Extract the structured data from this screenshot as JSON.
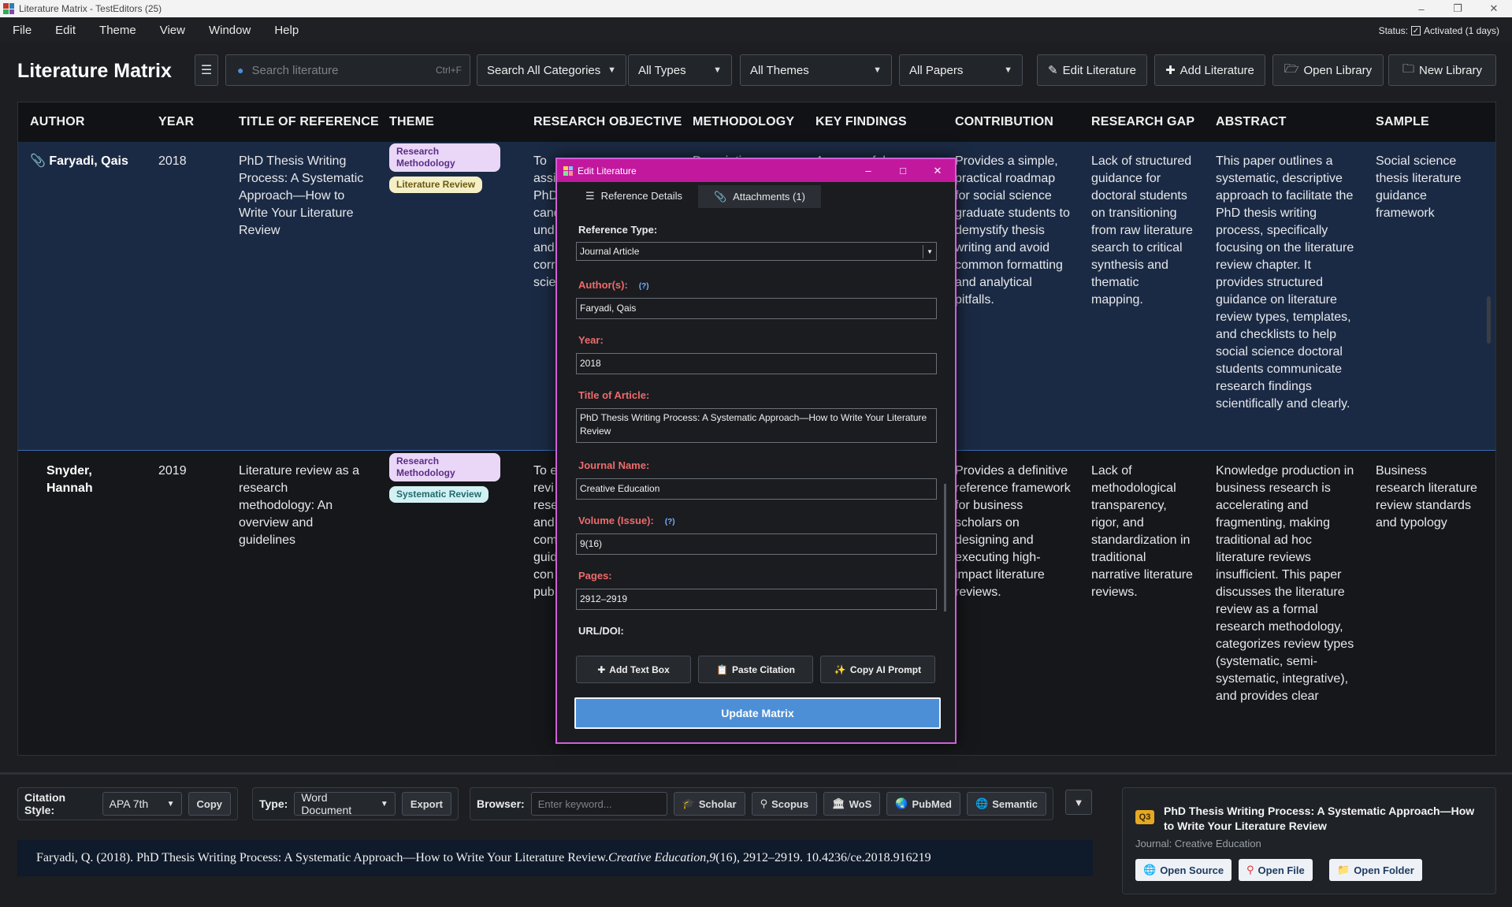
{
  "window": {
    "title": "Literature Matrix - TestEditors (25)"
  },
  "menu": [
    "File",
    "Edit",
    "Theme",
    "View",
    "Window",
    "Help"
  ],
  "status": {
    "label": "Status:",
    "value": "Activated (1 days)"
  },
  "toolbar": {
    "title": "Literature Matrix",
    "search_placeholder": "Search literature",
    "search_shortcut": "Ctrl+F",
    "filters": [
      "Search All Categories",
      "All Types",
      "All Themes",
      "All Papers"
    ],
    "buttons": [
      "Edit Literature",
      "Add Literature",
      "Open Library",
      "New Library"
    ]
  },
  "table": {
    "columns": [
      "AUTHOR",
      "YEAR",
      "TITLE OF REFERENCE",
      "THEME",
      "RESEARCH OBJECTIVE",
      "METHODOLOGY",
      "KEY FINDINGS",
      "CONTRIBUTION",
      "RESEARCH GAP",
      "ABSTRACT",
      "SAMPLE"
    ],
    "rows": [
      {
        "author": "Faryadi, Qais",
        "year": "2018",
        "title": "PhD Thesis Writing Process: A Systematic Approach—How to Write Your Literature Review",
        "themes": [
          "Research Methodology",
          "Literature Review"
        ],
        "objective": "To assist PhD cand und doc and liter corr scie",
        "methodology": "Descriptive",
        "findings": "A successful",
        "contribution": "Provides a simple, practical roadmap for social science graduate students to demystify thesis writing and avoid common formatting and analytical pitfalls.",
        "gap": "Lack of structured guidance for doctoral students on transitioning from raw literature search to critical synthesis and thematic mapping.",
        "abstract": "This paper outlines a systematic, descriptive approach to facilitate the PhD thesis writing process, specifically focusing on the literature review chapter. It provides structured guidance on literature review types, templates, and checklists to help social science doctoral students communicate research findings scientifically and clearly.",
        "sample": "Social science thesis literature guidance framework"
      },
      {
        "author": "Snyder, Hannah",
        "year": "2019",
        "title": "Literature review as a research methodology: An overview and guidelines",
        "themes": [
          "Research Methodology",
          "Systematic Review"
        ],
        "objective": "To e revi rese and com guid con pub",
        "methodology": "",
        "findings": "",
        "contribution": "Provides a definitive reference framework for business scholars on designing and executing high-impact literature reviews.",
        "gap": "Lack of methodological transparency, rigor, and standardization in traditional narrative literature reviews.",
        "abstract": "Knowledge production in business research is accelerating and fragmenting, making traditional ad hoc literature reviews insufficient. This paper discusses the literature review as a formal research methodology, categorizes review types (systematic, semi-systematic, integrative), and provides clear",
        "sample": "Business research literature review standards and typology"
      }
    ]
  },
  "modal": {
    "title": "Edit Literature",
    "tabs": [
      "Reference Details",
      "Attachments  (1)"
    ],
    "fields": {
      "ref_type_label": "Reference Type:",
      "ref_type_value": "Journal Article",
      "author_label": "Author(s):",
      "author_help": "(?)",
      "author_value": "Faryadi, Qais",
      "year_label": "Year:",
      "year_value": "2018",
      "title_label": "Title of Article:",
      "title_value": "PhD Thesis Writing Process: A Systematic Approach—How to Write Your Literature Review",
      "journal_label": "Journal Name:",
      "journal_value": "Creative Education",
      "volume_label": "Volume (Issue):",
      "volume_help": "(?)",
      "volume_value": "9(16)",
      "pages_label": "Pages:",
      "pages_value": "2912–2919",
      "url_label": "URL/DOI:"
    },
    "actions": [
      "Add Text Box",
      "Paste Citation",
      "Copy AI Prompt"
    ],
    "update_label": "Update Matrix"
  },
  "bottom": {
    "citation_style_label": "Citation Style:",
    "citation_style_value": "APA 7th",
    "copy_label": "Copy",
    "type_label": "Type:",
    "type_value": "Word Document",
    "export_label": "Export",
    "browser_label": "Browser:",
    "browser_placeholder": "Enter keyword...",
    "browser_buttons": [
      "Scholar",
      "Scopus",
      "WoS",
      "PubMed",
      "Semantic"
    ],
    "citation_pre": "Faryadi, Q. (2018). PhD Thesis Writing Process: A Systematic Approach—How to Write Your Literature Review. ",
    "citation_journal": "Creative Education",
    "citation_mid": ", ",
    "citation_vol": "9",
    "citation_post": "(16), 2912–2919. 10.4236/ce.2018.916219"
  },
  "card": {
    "badge": "Q3",
    "title": "PhD Thesis Writing Process: A Systematic Approach—How to Write Your Literature Review",
    "journal": "Journal: Creative Education",
    "buttons": [
      "Open Source",
      "Open File",
      "Open Folder"
    ]
  },
  "colors": {
    "accent": "#4d8fd6",
    "modal_title": "#c2189e",
    "required_label": "#ef6b6b"
  }
}
